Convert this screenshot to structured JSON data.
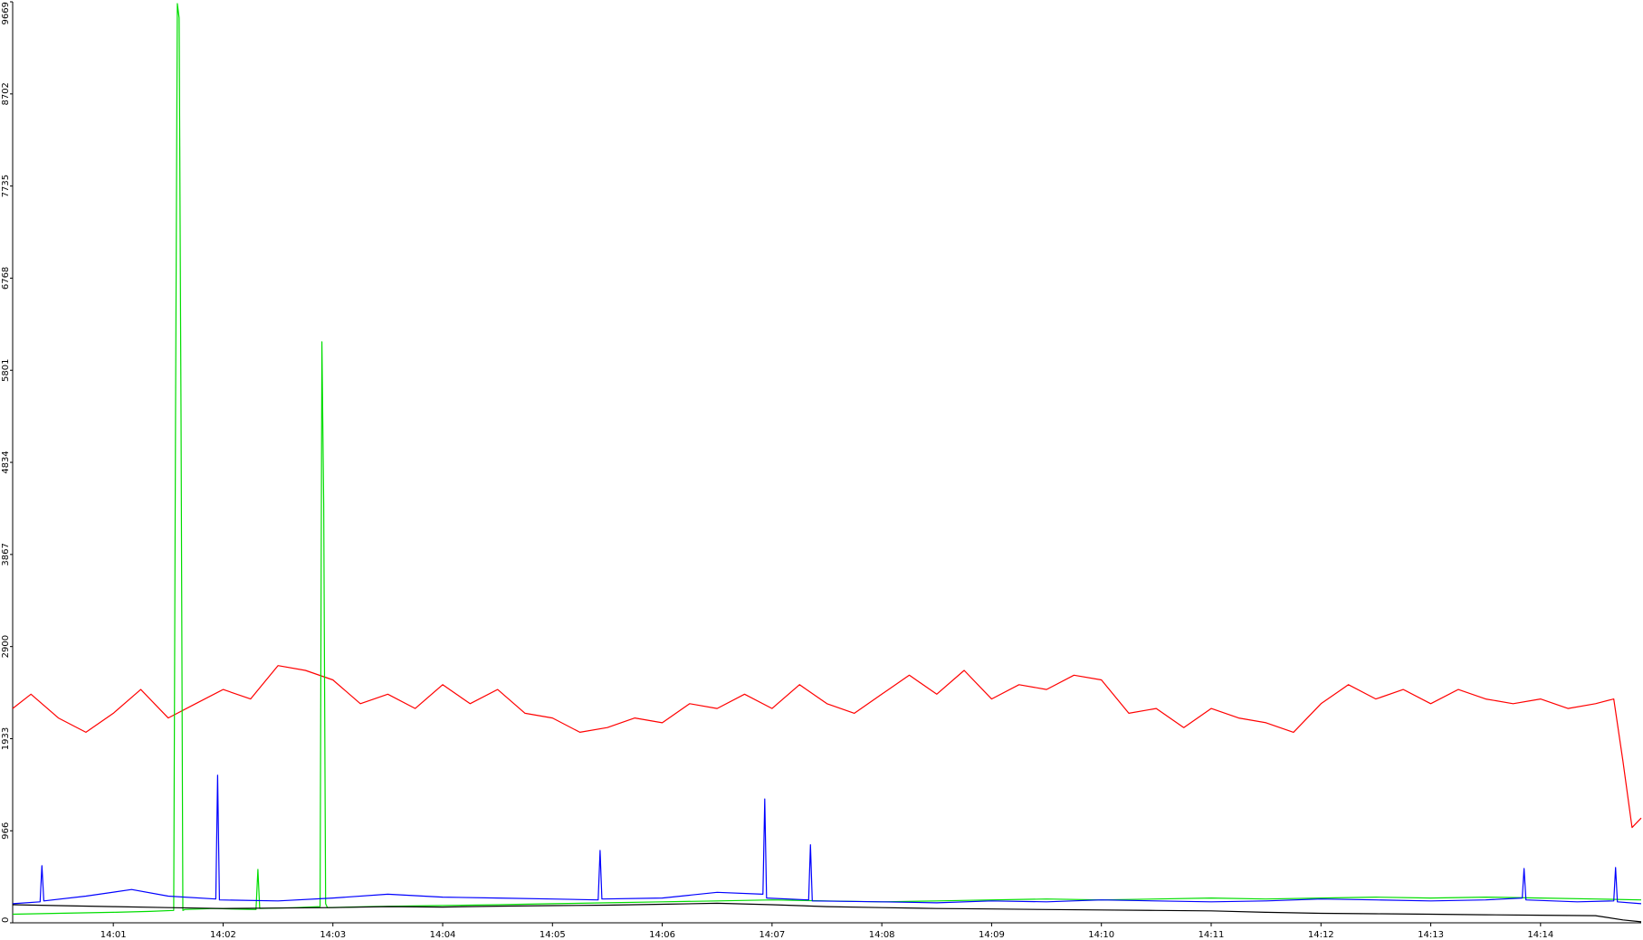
{
  "chart_data": {
    "type": "line",
    "title": "",
    "xlabel": "",
    "ylabel": "",
    "grid": false,
    "legend": "none",
    "x_ticks": [
      "14:01",
      "14:02",
      "14:03",
      "14:04",
      "14:05",
      "14:06",
      "14:07",
      "14:08",
      "14:09",
      "14:10",
      "14:11",
      "14:12",
      "14:13",
      "14:14"
    ],
    "y_ticks": [
      0,
      966,
      1933,
      2900,
      3867,
      4834,
      5801,
      6768,
      7735,
      8702,
      9669
    ],
    "xlim": [
      "14:00:05",
      "14:14:55"
    ],
    "ylim": [
      0,
      9669
    ],
    "series": [
      {
        "color": "#ff0000",
        "x": [
          "14:00:05",
          "14:00:15",
          "14:00:30",
          "14:00:45",
          "14:01:00",
          "14:01:15",
          "14:01:30",
          "14:01:45",
          "14:02:00",
          "14:02:15",
          "14:02:30",
          "14:02:45",
          "14:03:00",
          "14:03:15",
          "14:03:30",
          "14:03:45",
          "14:04:00",
          "14:04:15",
          "14:04:30",
          "14:04:45",
          "14:05:00",
          "14:05:15",
          "14:05:30",
          "14:05:45",
          "14:06:00",
          "14:06:15",
          "14:06:30",
          "14:06:45",
          "14:07:00",
          "14:07:15",
          "14:07:30",
          "14:07:45",
          "14:08:00",
          "14:08:15",
          "14:08:30",
          "14:08:45",
          "14:09:00",
          "14:09:15",
          "14:09:30",
          "14:09:45",
          "14:10:00",
          "14:10:15",
          "14:10:30",
          "14:10:45",
          "14:11:00",
          "14:11:15",
          "14:11:30",
          "14:11:45",
          "14:12:00",
          "14:12:15",
          "14:12:30",
          "14:12:45",
          "14:13:00",
          "14:13:15",
          "14:13:30",
          "14:13:45",
          "14:14:00",
          "14:14:15",
          "14:14:30",
          "14:14:40",
          "14:14:45",
          "14:14:50",
          "14:14:55"
        ],
        "y": [
          2250,
          2400,
          2150,
          2000,
          2200,
          2450,
          2150,
          2300,
          2450,
          2350,
          2700,
          2650,
          2550,
          2300,
          2400,
          2250,
          2500,
          2300,
          2450,
          2200,
          2150,
          2000,
          2050,
          2150,
          2100,
          2300,
          2250,
          2400,
          2250,
          2500,
          2300,
          2200,
          2400,
          2600,
          2400,
          2650,
          2350,
          2500,
          2450,
          2600,
          2550,
          2200,
          2250,
          2050,
          2250,
          2150,
          2100,
          2000,
          2300,
          2500,
          2350,
          2450,
          2300,
          2450,
          2350,
          2300,
          2350,
          2250,
          2300,
          2350,
          1700,
          1000,
          1100
        ]
      },
      {
        "color": "#00dd00",
        "x": [
          "14:00:05",
          "14:00:30",
          "14:01:00",
          "14:01:20",
          "14:01:33",
          "14:01:34",
          "14:01:35",
          "14:01:36",
          "14:01:37",
          "14:01:38",
          "14:01:39",
          "14:01:55",
          "14:02:18",
          "14:02:19",
          "14:02:20",
          "14:02:40",
          "14:02:53",
          "14:02:54",
          "14:02:55",
          "14:02:56",
          "14:02:57",
          "14:03:20",
          "14:03:55",
          "14:04:30",
          "14:05:00",
          "14:05:30",
          "14:06:00",
          "14:06:30",
          "14:07:00",
          "14:07:30",
          "14:08:00",
          "14:08:30",
          "14:09:00",
          "14:09:30",
          "14:10:00",
          "14:10:30",
          "14:11:00",
          "14:11:30",
          "14:12:00",
          "14:12:30",
          "14:13:00",
          "14:13:30",
          "14:14:00",
          "14:14:30",
          "14:14:55"
        ],
        "y": [
          90,
          100,
          110,
          120,
          130,
          5300,
          9650,
          9500,
          5300,
          130,
          140,
          150,
          140,
          560,
          150,
          160,
          170,
          6100,
          4400,
          200,
          160,
          170,
          180,
          190,
          200,
          210,
          220,
          230,
          240,
          230,
          220,
          230,
          240,
          250,
          240,
          250,
          260,
          250,
          260,
          270,
          260,
          270,
          260,
          250,
          240
        ]
      },
      {
        "color": "#0000ff",
        "x": [
          "14:00:05",
          "14:00:20",
          "14:00:21",
          "14:00:22",
          "14:00:45",
          "14:01:10",
          "14:01:30",
          "14:01:56",
          "14:01:57",
          "14:01:58",
          "14:02:30",
          "14:03:00",
          "14:03:30",
          "14:04:00",
          "14:04:30",
          "14:05:00",
          "14:05:25",
          "14:05:26",
          "14:05:27",
          "14:06:00",
          "14:06:30",
          "14:06:55",
          "14:06:56",
          "14:06:57",
          "14:07:20",
          "14:07:21",
          "14:07:22",
          "14:08:00",
          "14:08:30",
          "14:09:00",
          "14:09:30",
          "14:10:00",
          "14:10:30",
          "14:11:00",
          "14:11:30",
          "14:12:00",
          "14:12:30",
          "14:13:00",
          "14:13:30",
          "14:13:50",
          "14:13:51",
          "14:13:52",
          "14:14:20",
          "14:14:40",
          "14:14:41",
          "14:14:42",
          "14:14:55"
        ],
        "y": [
          200,
          220,
          600,
          230,
          280,
          350,
          280,
          250,
          1550,
          240,
          230,
          260,
          300,
          270,
          260,
          250,
          240,
          760,
          250,
          260,
          320,
          300,
          1300,
          260,
          240,
          820,
          230,
          220,
          210,
          230,
          220,
          240,
          230,
          220,
          230,
          250,
          240,
          230,
          240,
          260,
          570,
          240,
          220,
          230,
          580,
          220,
          200
        ]
      },
      {
        "color": "#000000",
        "x": [
          "14:00:05",
          "14:00:30",
          "14:01:00",
          "14:01:30",
          "14:02:00",
          "14:02:30",
          "14:03:00",
          "14:03:30",
          "14:04:00",
          "14:04:30",
          "14:05:00",
          "14:05:30",
          "14:06:00",
          "14:06:30",
          "14:07:00",
          "14:07:30",
          "14:08:00",
          "14:08:30",
          "14:09:00",
          "14:09:30",
          "14:10:00",
          "14:10:30",
          "14:11:00",
          "14:11:30",
          "14:12:00",
          "14:12:30",
          "14:13:00",
          "14:13:30",
          "14:14:00",
          "14:14:30",
          "14:14:45",
          "14:14:55"
        ],
        "y": [
          190,
          180,
          170,
          160,
          150,
          155,
          160,
          170,
          165,
          175,
          180,
          185,
          195,
          205,
          190,
          170,
          160,
          150,
          145,
          140,
          135,
          130,
          125,
          110,
          100,
          95,
          90,
          85,
          80,
          75,
          30,
          10
        ]
      }
    ]
  }
}
